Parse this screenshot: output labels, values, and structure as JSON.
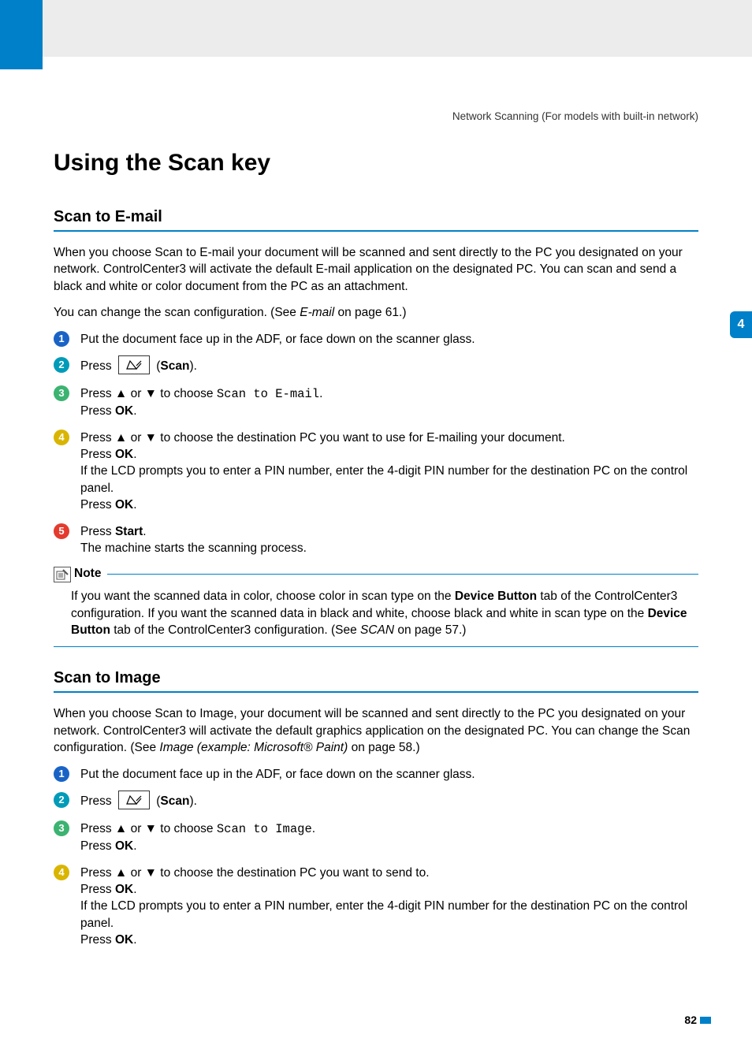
{
  "header": {
    "right": "Network Scanning (For models with built-in network)"
  },
  "sidetab": "4",
  "page_number": "82",
  "title": "Using the Scan key",
  "scan_label": "Scan",
  "email": {
    "heading": "Scan to E-mail",
    "intro": "When you choose Scan to E-mail your document will be scanned and sent directly to the PC you designated on your network. ControlCenter3 will activate the default E-mail application on the designated PC. You can scan and send a black and white or color document from the PC as an attachment.",
    "config_pre": "You can change the scan configuration. (See ",
    "config_link": "E-mail",
    "config_post": " on page 61.)",
    "step1": "Put the document face up in the ADF, or face down on the scanner glass.",
    "step2_pre": "Press ",
    "step2_post": ").",
    "step3_pre": "Press ▲ or ▼ to choose ",
    "step3_mono": "Scan to E-mail",
    "step3_post": ".",
    "press_ok": "Press ",
    "ok": "OK",
    "step4a": "Press ▲ or ▼ to choose the destination PC you want to use for E-mailing your document.",
    "step4b": "If the LCD prompts you to enter a PIN number, enter the 4-digit PIN number for the destination PC on the control panel.",
    "step5_pre": "Press ",
    "start": "Start",
    "step5_body": "The machine starts the scanning process.",
    "note_label": "Note",
    "note_pre": "If you want the scanned data in color, choose color in scan type on the ",
    "device_button": "Device Button",
    "note_mid1": " tab of the ControlCenter3 configuration. If you want the scanned data in black and white, choose black and white in scan type on the ",
    "note_mid2": " tab of the ControlCenter3 configuration. (See ",
    "scan_link": "SCAN",
    "note_end": " on page 57.)"
  },
  "image": {
    "heading": "Scan to Image",
    "intro_pre": "When you choose Scan to Image, your document will be scanned and sent directly to the PC you designated on your network. ControlCenter3 will activate the default graphics application on the designated PC. You can change the Scan configuration. (See ",
    "intro_link": "Image (example: Microsoft® Paint)",
    "intro_post": " on page 58.)",
    "step1": "Put the document face up in the ADF, or face down on the scanner glass.",
    "step2_pre": "Press ",
    "step2_post": ").",
    "step3_pre": "Press ▲ or ▼ to choose ",
    "step3_mono": "Scan to Image",
    "step3_post": ".",
    "step4a": "Press ▲ or ▼ to choose the destination PC you want to send to.",
    "step4b": "If the LCD prompts you to enter a PIN number, enter the 4-digit PIN number for the destination PC on the control panel."
  }
}
